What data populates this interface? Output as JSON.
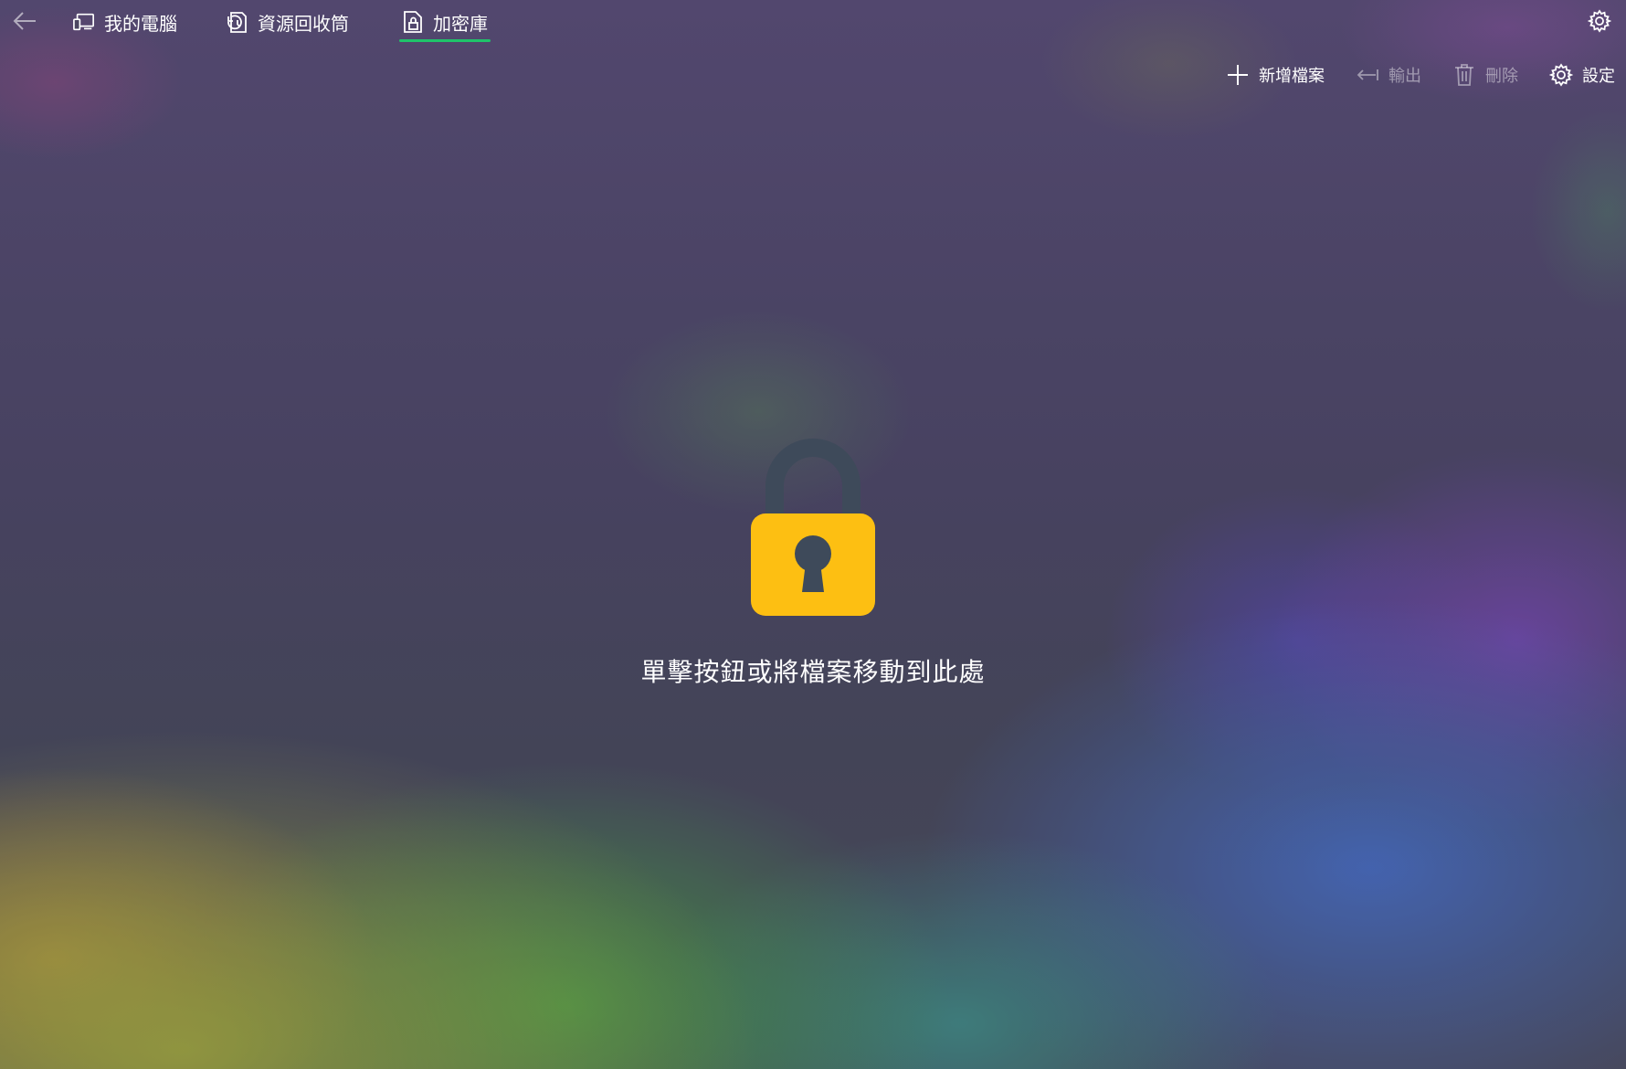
{
  "nav": {
    "back_icon": "back-arrow-icon",
    "tabs": [
      {
        "label": "我的電腦",
        "icon": "computer-icon",
        "active": false
      },
      {
        "label": "資源回收筒",
        "icon": "recycle-restore-icon",
        "active": false
      },
      {
        "label": "加密庫",
        "icon": "vault-file-lock-icon",
        "active": true
      }
    ],
    "settings_icon": "gear-icon"
  },
  "toolbar": {
    "add_label": "新增檔案",
    "export_label": "輸出",
    "delete_label": "刪除",
    "settings_label": "設定"
  },
  "empty_state": {
    "message": "單擊按鈕或將檔案移動到此處",
    "icon": "padlock-icon"
  },
  "colors": {
    "accent_underline": "#1fc46a",
    "lock_body": "#fdbf12",
    "lock_shackle": "#3e4a5a"
  }
}
